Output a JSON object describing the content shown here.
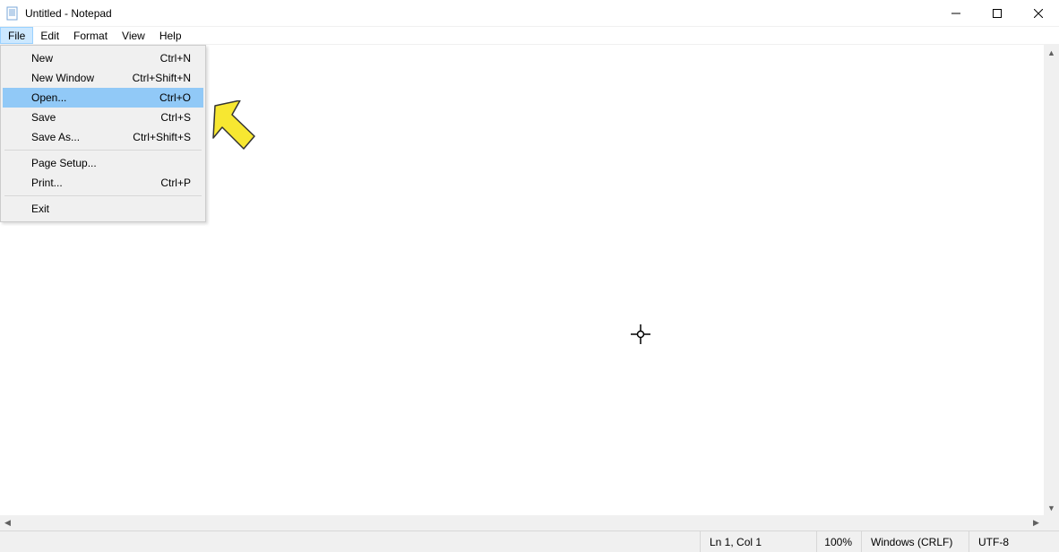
{
  "window": {
    "title": "Untitled - Notepad"
  },
  "menubar": {
    "items": [
      "File",
      "Edit",
      "Format",
      "View",
      "Help"
    ],
    "active_index": 0
  },
  "file_menu": {
    "items": [
      {
        "label": "New",
        "shortcut": "Ctrl+N"
      },
      {
        "label": "New Window",
        "shortcut": "Ctrl+Shift+N"
      },
      {
        "label": "Open...",
        "shortcut": "Ctrl+O",
        "highlight": true
      },
      {
        "label": "Save",
        "shortcut": "Ctrl+S"
      },
      {
        "label": "Save As...",
        "shortcut": "Ctrl+Shift+S"
      },
      {
        "sep": true
      },
      {
        "label": "Page Setup...",
        "shortcut": ""
      },
      {
        "label": "Print...",
        "shortcut": "Ctrl+P"
      },
      {
        "sep": true
      },
      {
        "label": "Exit",
        "shortcut": ""
      }
    ]
  },
  "statusbar": {
    "position": "Ln 1, Col 1",
    "zoom": "100%",
    "line_ending": "Windows (CRLF)",
    "encoding": "UTF-8"
  }
}
